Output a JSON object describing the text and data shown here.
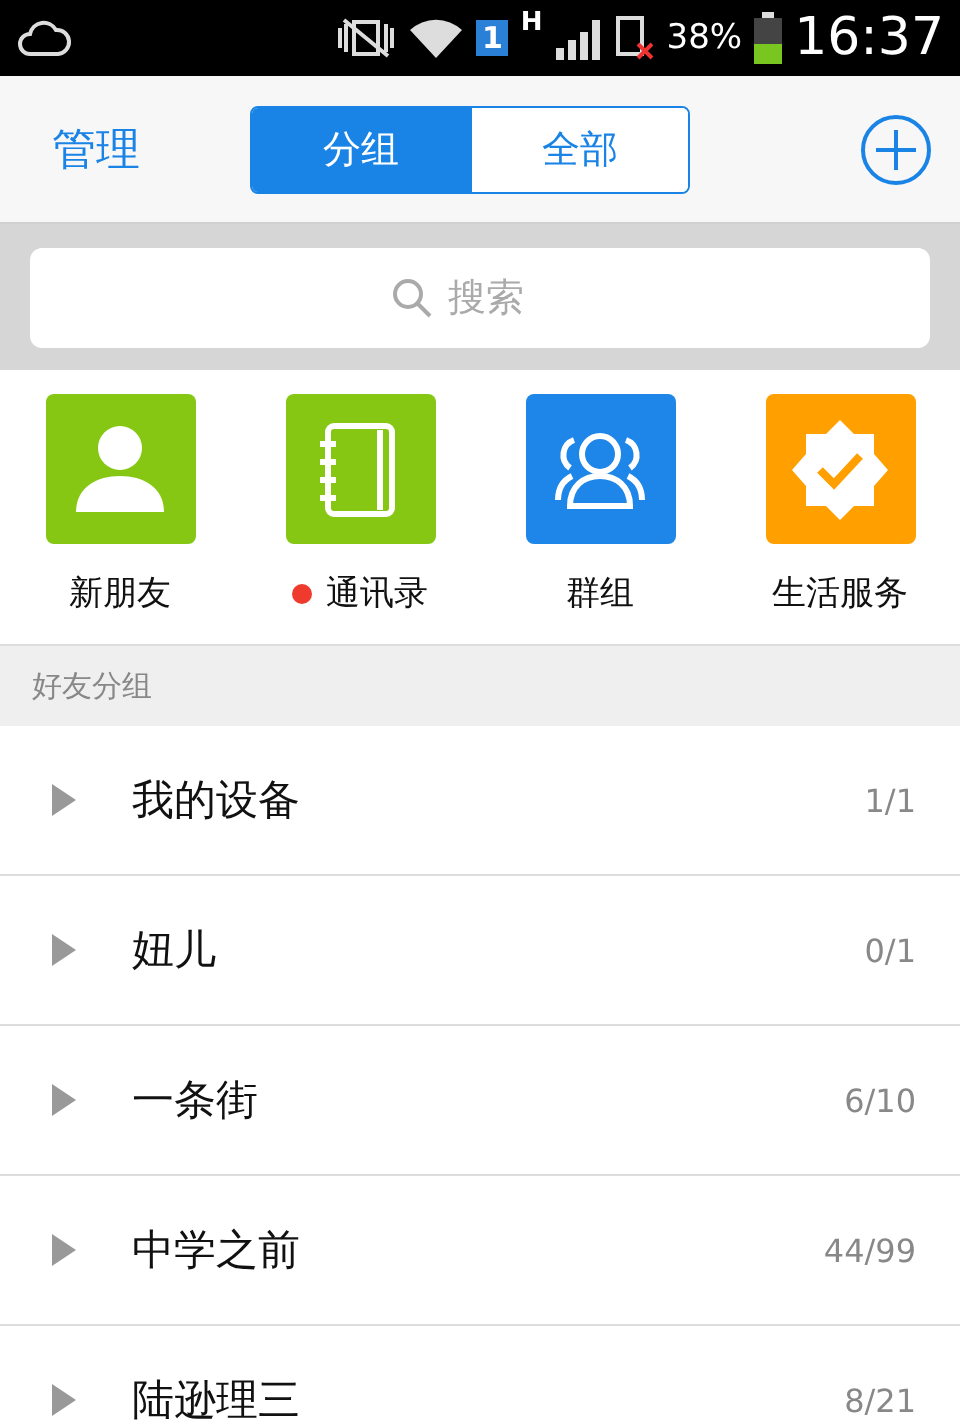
{
  "status_bar": {
    "sim_badge": "1",
    "network": "H",
    "battery_text": "38%",
    "time": "16:37"
  },
  "header": {
    "title": "管理",
    "segments": [
      {
        "label": "分组",
        "selected": true
      },
      {
        "label": "全部",
        "selected": false
      }
    ]
  },
  "search": {
    "placeholder": "搜索"
  },
  "shortcuts": [
    {
      "kind": "person",
      "label": "新朋友",
      "color": "#86c714",
      "badge": false
    },
    {
      "kind": "contacts",
      "label": "通讯录",
      "color": "#86c714",
      "badge": true
    },
    {
      "kind": "group",
      "label": "群组",
      "color": "#1e86e8",
      "badge": false
    },
    {
      "kind": "service",
      "label": "生活服务",
      "color": "#ffa000",
      "badge": false
    }
  ],
  "section": {
    "title": "好友分组"
  },
  "groups": [
    {
      "name": "我的设备",
      "count": "1/1",
      "expanded": false
    },
    {
      "name": "妞儿",
      "count": "0/1",
      "expanded": false
    },
    {
      "name": "一条街",
      "count": "6/10",
      "expanded": false
    },
    {
      "name": "中学之前",
      "count": "44/99",
      "expanded": false
    },
    {
      "name": "陆逊理三",
      "count": "8/21",
      "expanded": false
    }
  ]
}
